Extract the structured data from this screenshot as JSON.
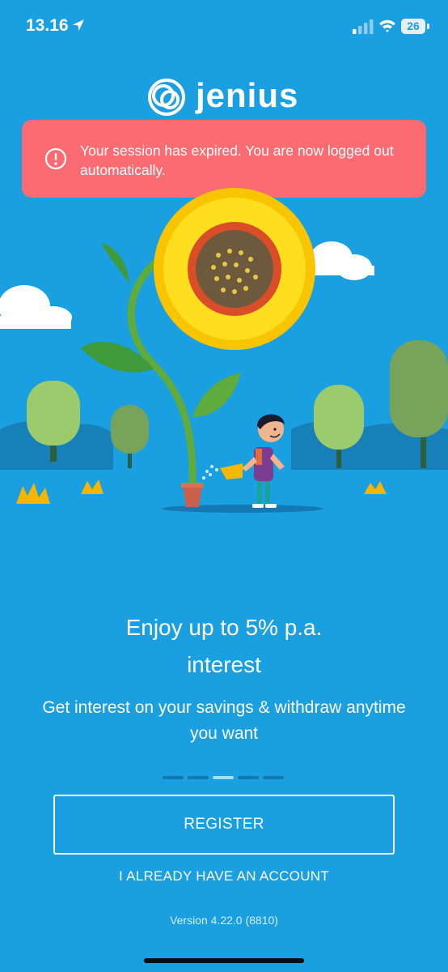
{
  "status_bar": {
    "time": "13.16",
    "battery": "26",
    "icons": [
      "location-arrow-icon",
      "signal-icon",
      "wifi-icon",
      "battery-icon"
    ]
  },
  "brand": {
    "name": "jenius",
    "logo_icon": "jenius-swirl-logo"
  },
  "alert": {
    "icon": "alert-circle-icon",
    "message": "Your session has expired. You are now logged out automatically.",
    "background": "#fb6b72"
  },
  "onboarding": {
    "headline_line1": "Enjoy up to 5% p.a.",
    "headline_line2": "interest",
    "subtitle": "Get interest on your savings & withdraw anytime you want",
    "page_count": 5,
    "active_page": 3
  },
  "actions": {
    "register_label": "REGISTER",
    "login_label": "I ALREADY HAVE AN ACCOUNT"
  },
  "footer": {
    "version": "Version 4.22.0 (8810)"
  },
  "colors": {
    "background": "#1a9fe0",
    "alert": "#fb6b72",
    "text": "#ffffff"
  }
}
